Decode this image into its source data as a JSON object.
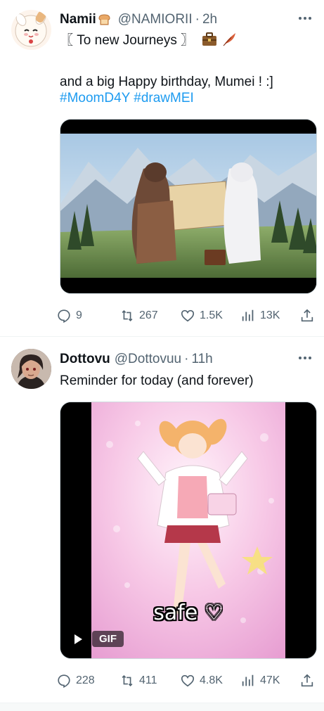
{
  "tweets": [
    {
      "name": "Namii",
      "handle": "@NAMIORII",
      "separator": "·",
      "time": "2h",
      "line1": "〖 To new Journeys 〗",
      "line2": "and a big Happy birthday, Mumei ! :]",
      "hashtags": [
        "#MoomD4Y",
        "#drawMEI"
      ],
      "actions": {
        "replies": "9",
        "reposts": "267",
        "likes": "1.5K",
        "views": "13K"
      },
      "icons": {
        "badge": "bread-icon",
        "trailing": [
          "briefcase-icon",
          "feather-icon"
        ]
      }
    },
    {
      "name": "Dottovu",
      "handle": "@Dottovuu",
      "separator": "·",
      "time": "11h",
      "line1": "Reminder for today (and forever)",
      "media_caption": "safe ♡",
      "gif_label": "GIF",
      "actions": {
        "replies": "228",
        "reposts": "411",
        "likes": "4.8K",
        "views": "47K"
      }
    }
  ],
  "colors": {
    "accent": "#1d9bf0",
    "secondary": "#536471",
    "text": "#0f1419",
    "border": "#eff3f4"
  }
}
